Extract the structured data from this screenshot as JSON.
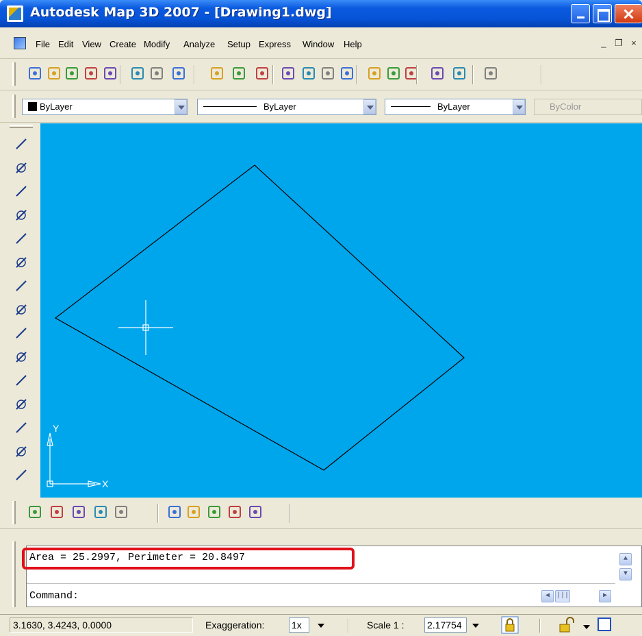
{
  "window": {
    "title": "Autodesk Map 3D 2007 - [Drawing1.dwg]",
    "controls": [
      "minimize",
      "maximize",
      "close"
    ]
  },
  "menu": {
    "items": [
      "File",
      "Edit",
      "View",
      "Create",
      "Modify",
      "Analyze",
      "Setup",
      "Express",
      "Window",
      "Help"
    ],
    "mdi_min": "_",
    "mdi_restore": "❐",
    "mdi_close": "×"
  },
  "toolbar_standard": {
    "icons": [
      "new-icon",
      "open-icon",
      "save-icon",
      "cut-icon",
      "copy-icon",
      "paste-icon",
      "match-properties-icon",
      "undo-icon",
      "redo-icon",
      "pan-icon",
      "zoom-realtime-icon",
      "zoom-window-icon",
      "zoom-previous-icon",
      "properties-icon",
      "design-center-icon",
      "help-icon",
      "snap-icon",
      "map-globe-icon",
      "refresh-icon",
      "query-icon",
      "layers-icon"
    ]
  },
  "properties_bar": {
    "layer": "ByLayer",
    "linetype": "ByLayer",
    "lineweight": "ByLayer",
    "plotstyle": "ByColor"
  },
  "draw_toolbar": {
    "icons": [
      "line-icon",
      "construction-line-icon",
      "polyline-icon",
      "polygon-icon",
      "rectangle-icon",
      "arc-icon",
      "circle-icon",
      "revision-cloud-icon",
      "spline-icon",
      "ellipse-icon",
      "ellipse-arc-icon",
      "insert-block-icon",
      "make-block-icon",
      "point-icon",
      "hatch-icon"
    ]
  },
  "drawing": {
    "background": "#00a6ec",
    "ucs_x_label": "X",
    "ucs_y_label": "Y"
  },
  "map_toolbar": {
    "icons": [
      "target-icon",
      "polygon-tool-icon",
      "flag-icon",
      "triangle-tool-icon",
      "curve-tool-icon",
      "map-tool-1-icon",
      "map-tool-2-icon",
      "map-tool-3-icon",
      "map-tool-add-icon",
      "map-tool-4-icon"
    ]
  },
  "command": {
    "output": "Area = 25.2997, Perimeter = 20.8497",
    "prompt": "Command:"
  },
  "status": {
    "coordinates": "3.1630, 3.4243, 0.0000",
    "exaggeration_label": "Exaggeration:",
    "exaggeration_value": "1x",
    "scale_label": "Scale 1 :",
    "scale_value": "2.17754"
  },
  "colors": {
    "highlight": "#e0101a",
    "drawing_bg": "#00a6ec",
    "titlebar": "#0653d6"
  }
}
